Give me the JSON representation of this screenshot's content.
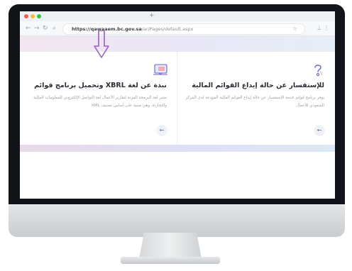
{
  "browser": {
    "url_host": "https://qawaaem.bc.gov.sa",
    "url_path": "/ar/Pages/default.aspx",
    "tab_add_label": "+"
  },
  "cards": [
    {
      "title": "نبذة عن لغة XBRL وتحميل برنامج قوائم",
      "desc": "تعتبر لغة البرمجة المرنة لتقارير الأعمال لغة التواصل الإلكتروني للمعلومات المالية والتجارية، وهي مبنية على أساس تصنيف XML",
      "icon": "screen-download-icon"
    },
    {
      "title": "للإستفسار عن حالة إيداع القوائم المالية",
      "desc": "يوفر برنامج قوائم خدمة الإستفسار عن حالة إيداع القوائم المالية المودعة لدى المركز السعودي للأعمال",
      "icon": "question-icon"
    }
  ],
  "colors": {
    "accent": "#7b4fa3",
    "arrow": "#9a5fc0",
    "button_arrow": "#5a6c8a"
  }
}
